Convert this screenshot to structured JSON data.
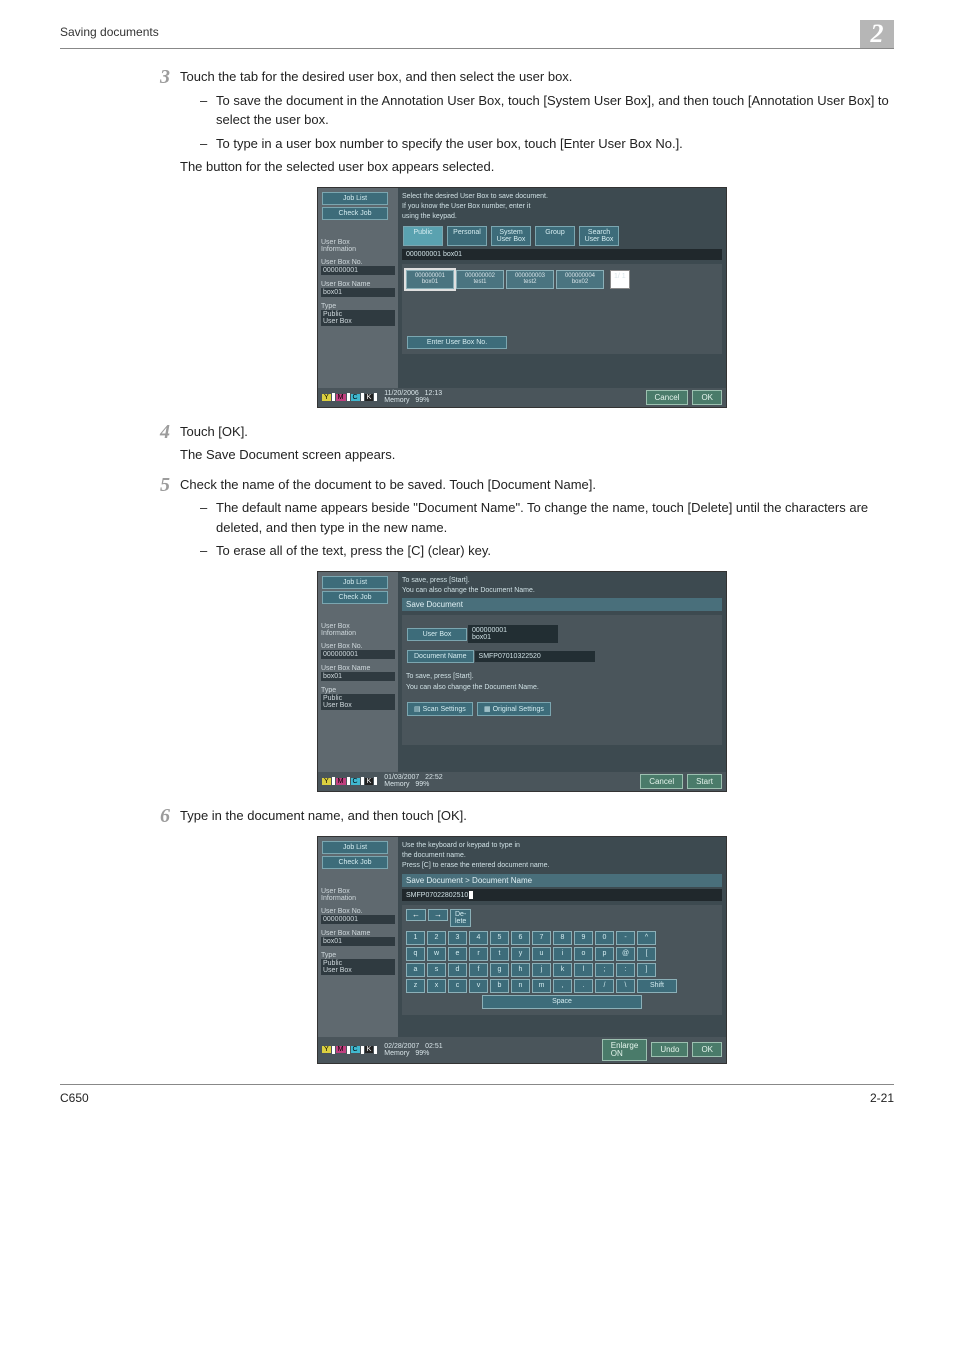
{
  "header": {
    "title": "Saving documents",
    "chapter": "2"
  },
  "steps": {
    "s3": {
      "num": "3",
      "text": "Touch the tab for the desired user box, and then select the user box.",
      "sub1": "To save the document in the Annotation User Box, touch [System User Box], and then touch [Annotation User Box] to select the user box.",
      "sub2": "To type in a user box number to specify the user box, touch [Enter User Box No.].",
      "tail": "The button for the selected user box appears selected."
    },
    "s4": {
      "num": "4",
      "text": "Touch [OK].",
      "tail": "The Save Document screen appears."
    },
    "s5": {
      "num": "5",
      "text": "Check the name of the document to be saved. Touch [Document Name].",
      "sub1": "The default name appears beside \"Document Name\". To change the name, touch [Delete] until the characters are deleted, and then type in the new name.",
      "sub2": "To erase all of the text, press the [C] (clear) key."
    },
    "s6": {
      "num": "6",
      "text": "Type in the document name, and then touch [OK]."
    }
  },
  "screen1": {
    "job_list": "Job List",
    "check_job": "Check Job",
    "ub_info": "User Box\nInformation",
    "ub_no_lbl": "User Box No.",
    "ub_no_val": "000000001",
    "ub_name_lbl": "User Box Name",
    "ub_name_val": "box01",
    "type_lbl": "Type",
    "type_val": "Public\nUser Box",
    "prompt1": "Select the desired User Box to save document.",
    "prompt2": "If you know the User Box number, enter it",
    "prompt3": "using the keypad.",
    "tabs": {
      "public": "Public",
      "personal": "Personal",
      "system": "System\nUser Box",
      "group": "Group",
      "search": "Search\nUser Box"
    },
    "selected_box_line": "000000001   box01",
    "boxes": [
      {
        "no": "000000001",
        "name": "box01"
      },
      {
        "no": "000000002",
        "name": "test1"
      },
      {
        "no": "000000003",
        "name": "test2"
      },
      {
        "no": "000000004",
        "name": "box02"
      }
    ],
    "page_ind": "1/ 1",
    "enter_box_no": "Enter User Box No.",
    "cancel": "Cancel",
    "ok": "OK",
    "date": "11/20/2006",
    "time": "12:13",
    "mem_lbl": "Memory",
    "mem_val": "99%"
  },
  "screen2": {
    "job_list": "Job List",
    "check_job": "Check Job",
    "ub_info": "User Box\nInformation",
    "ub_no_lbl": "User Box No.",
    "ub_no_val": "000000001",
    "ub_name_lbl": "User Box Name",
    "ub_name_val": "box01",
    "type_lbl": "Type",
    "type_val": "Public\nUser Box",
    "prompt1": "To save, press [Start].",
    "prompt2": "You can also change the Document Name.",
    "title_bar": "Save Document",
    "user_box_btn": "User Box",
    "user_box_val_no": "000000001",
    "user_box_val_name": "box01",
    "doc_name_btn": "Document Name",
    "doc_name_val": "SMFP07010322520",
    "help1": "To save, press [Start].",
    "help2": "You can also change the Document Name.",
    "scan_settings": "Scan Settings",
    "orig_settings": "Original Settings",
    "cancel": "Cancel",
    "start": "Start",
    "date": "01/03/2007",
    "time": "22:52",
    "mem_lbl": "Memory",
    "mem_val": "99%"
  },
  "screen3": {
    "job_list": "Job List",
    "check_job": "Check Job",
    "ub_info": "User Box\nInformation",
    "ub_no_lbl": "User Box No.",
    "ub_no_val": "000000001",
    "ub_name_lbl": "User Box Name",
    "ub_name_val": "box01",
    "type_lbl": "Type",
    "type_val": "Public\nUser Box",
    "prompt1": "Use the keyboard or keypad to type in",
    "prompt2": "the document name.",
    "prompt3": "Press [C] to erase the entered document name.",
    "breadcrumb": "Save Document > Document Name",
    "input_val": "SMFP07022802510",
    "del_label": "De-\nlete",
    "keyboard": {
      "row1": [
        "1",
        "2",
        "3",
        "4",
        "5",
        "6",
        "7",
        "8",
        "9",
        "0",
        "-",
        "^"
      ],
      "row2": [
        "q",
        "w",
        "e",
        "r",
        "t",
        "y",
        "u",
        "i",
        "o",
        "p",
        "@",
        "["
      ],
      "row3": [
        "a",
        "s",
        "d",
        "f",
        "g",
        "h",
        "j",
        "k",
        "l",
        ";",
        ":",
        "]"
      ],
      "row4": [
        "z",
        "x",
        "c",
        "v",
        "b",
        "n",
        "m",
        ",",
        ".",
        "/",
        "\\"
      ],
      "shift": "Shift",
      "space": "Space"
    },
    "enlarge": "Enlarge\nON",
    "undo": "Undo",
    "ok": "OK",
    "date": "02/28/2007",
    "time": "02:51",
    "mem_lbl": "Memory",
    "mem_val": "99%"
  },
  "footer": {
    "model": "C650",
    "page": "2-21"
  }
}
